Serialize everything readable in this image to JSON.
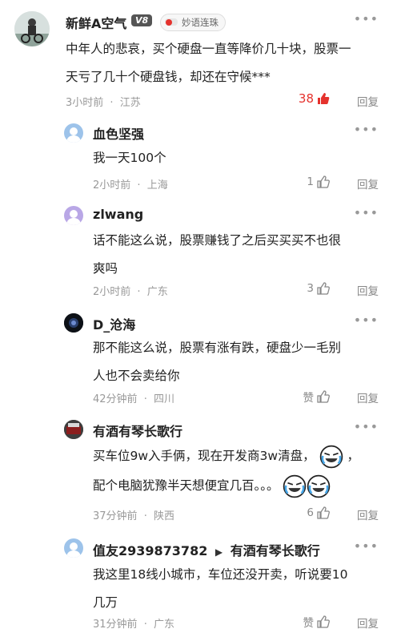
{
  "comments": [
    {
      "user": "新鲜A空气",
      "level": "V8",
      "medal": "妙语连珠",
      "text_lines": [
        "中年人的悲哀，买个硬盘一直等降价几十块，股票一",
        "天亏了几十个硬盘钱，却还在守候***"
      ],
      "time": "3小时前",
      "location": "江苏",
      "likes": "38",
      "reply": "回复"
    },
    {
      "user": "血色坚强",
      "text_lines": [
        "我一天100个"
      ],
      "time": "2小时前",
      "location": "上海",
      "likes": "1",
      "reply": "回复"
    },
    {
      "user": "zlwang",
      "text_lines": [
        "话不能这么说，股票赚钱了之后买买买不也很",
        "爽吗"
      ],
      "time": "2小时前",
      "location": "广东",
      "likes": "3",
      "reply": "回复"
    },
    {
      "user": "D_沧海",
      "text_lines": [
        "那不能这么说，股票有涨有跌，硬盘少一毛别",
        "人也不会卖给你"
      ],
      "time": "42分钟前",
      "location": "四川",
      "likes": "赞",
      "reply": "回复"
    },
    {
      "user": "有酒有琴长歌行",
      "text_lines": [
        "买车位9w入手俩，现在开发商3w清盘，",
        "配个电脑犹豫半天想便宜几百。。。"
      ],
      "time": "37分钟前",
      "location": "陕西",
      "likes": "6",
      "reply": "回复"
    },
    {
      "user": "值友2939873782",
      "reply_to": "有酒有琴长歌行",
      "text_lines": [
        "我这里18线小城市，车位还没开卖，听说要10",
        "几万"
      ],
      "time": "31分钟前",
      "location": "广东",
      "likes": "赞",
      "reply": "回复"
    }
  ],
  "separator": "·",
  "more_symbol": "•••",
  "colors": {
    "liked": "#e5322d",
    "meta": "#999999",
    "avatar_default": "#9dc3ea",
    "avatar_purple": "#b9a7e6"
  }
}
